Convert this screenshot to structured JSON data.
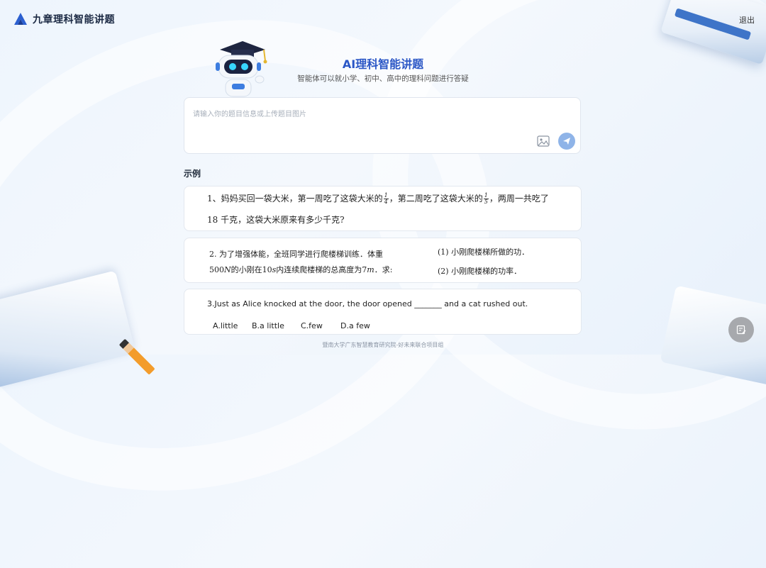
{
  "brand": {
    "name": "九章理科智能讲题"
  },
  "header": {
    "logout_label": "退出"
  },
  "hero": {
    "title": "AI理科智能讲题",
    "subtitle": "智能体可以就小学、初中、高中的理科问题进行答疑"
  },
  "input": {
    "placeholder": "请输入你的题目信息或上传题目图片",
    "value": ""
  },
  "examples": {
    "label": "示例",
    "ex1": {
      "line1_a": "1、妈妈买回一袋大米，第一周吃了这袋大米的",
      "frac1_num": "1",
      "frac1_den": "4",
      "line1_b": "，第二周吃了这袋大米的",
      "frac2_num": "1",
      "frac2_den": "5",
      "line1_c": "，两周一共吃了",
      "line2": "18 千克，这袋大米原来有多少千克?"
    },
    "ex2": {
      "left1": "2. 为了增强体能，全班同学进行爬楼梯训练．体重",
      "left2_a": "500",
      "left2_b": "N",
      "left2_c": "的小刚在",
      "left2_d": "10",
      "left2_e": "s",
      "left2_f": "内连续爬楼梯的总高度为",
      "left2_g": "7",
      "left2_h": "m",
      "left2_i": "．求:",
      "right1": "(1) 小刚爬楼梯所做的功．",
      "right2": "(2) 小刚爬楼梯的功率．"
    },
    "ex3": {
      "question": "3.Just as Alice knocked at the door, the door opened _______ and a cat rushed out.",
      "options": [
        "A.little",
        "B.a little",
        "C.few",
        "D.a few"
      ]
    }
  },
  "footer": {
    "text": "暨南大学广东智慧教育研究院-好未来联合项目组"
  },
  "colors": {
    "accent": "#2b57c6",
    "send": "#8fb4e8"
  }
}
